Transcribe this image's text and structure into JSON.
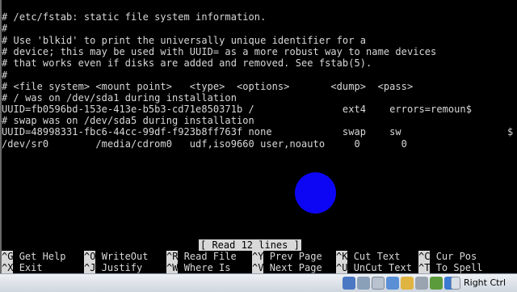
{
  "terminal": {
    "lines": [
      "# /etc/fstab: static file system information.",
      "#",
      "# Use 'blkid' to print the universally unique identifier for a",
      "# device; this may be used with UUID= as a more robust way to name devices",
      "# that works even if disks are added and removed. See fstab(5).",
      "#",
      "# <file system> <mount point>   <type>  <options>       <dump>  <pass>",
      "# / was on /dev/sda1 during installation",
      "UUID=fb0596bd-153e-413e-b5b3-cd71e850371b /               ext4    errors=remoun$",
      "# swap was on /dev/sda5 during installation",
      "UUID=48998331-fbc6-44cc-99df-f923b8ff763f none            swap    sw",
      "/dev/sr0        /media/cdrom0   udf,iso9660 user,noauto     0       0"
    ],
    "overflow_marker": "$"
  },
  "status": "[ Read 12 lines ]",
  "shortcuts": [
    {
      "key": "^G",
      "label": "Get Help"
    },
    {
      "key": "^O",
      "label": "WriteOut"
    },
    {
      "key": "^R",
      "label": "Read File"
    },
    {
      "key": "^Y",
      "label": "Prev Page"
    },
    {
      "key": "^K",
      "label": "Cut Text"
    },
    {
      "key": "^C",
      "label": "Cur Pos"
    },
    {
      "key": "^X",
      "label": "Exit"
    },
    {
      "key": "^J",
      "label": "Justify"
    },
    {
      "key": "^W",
      "label": "Where Is"
    },
    {
      "key": "^V",
      "label": "Next Page"
    },
    {
      "key": "^U",
      "label": "UnCut Text"
    },
    {
      "key": "^T",
      "label": "To Spell"
    }
  ],
  "taskbar": {
    "host_key": "Right Ctrl",
    "tray_icons": [
      "disk-icon",
      "network-icon",
      "pen-icon",
      "display-icon",
      "folder-icon",
      "monitor-icon",
      "screen-icon",
      "usb-icon",
      "gear-icon",
      "host-icon"
    ]
  },
  "colors": {
    "background": "#000000",
    "text": "#d8d8d8",
    "dot": "#0d06f5"
  }
}
